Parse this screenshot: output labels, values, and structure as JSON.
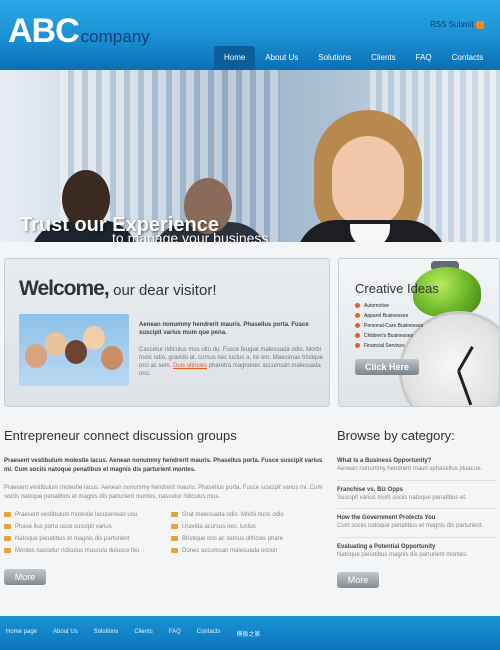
{
  "header": {
    "logo_main": "ABC",
    "logo_sub": "company",
    "rss_label": "RSS Submit",
    "nav": [
      "Home",
      "About Us",
      "Solutions",
      "Clients",
      "FAQ",
      "Contacts"
    ],
    "nav_active": "Home"
  },
  "hero": {
    "title": "Trust our Experience",
    "subtitle": "to manage your business..."
  },
  "welcome": {
    "title_big": "Welcome,",
    "title_small": "our dear visitor!",
    "bold_text": "Aenean nonummy hendrerit mauris. Phasellus porta. Fusce suscipit varius mum que pena.",
    "body_text": "Cascetur ridiculus mus ulto du. Fusce feugiat malesuada odio. Morbi nunc odio, gravido at, cursus nec luctus a, lor em. Maecenas tristique orci ac sem.",
    "link_text": "Duis ultricies",
    "body_text_end": "pharetra magnonec accumsan malesuada orci."
  },
  "creative": {
    "title": "Creative Ideas",
    "items": [
      "Automotive",
      "Apparel Businesses",
      "Personal-Care Businesses",
      "Children's Businesses",
      "Financial Services"
    ],
    "button": "Click Here"
  },
  "entrepreneur": {
    "title": "Entrepreneur connect discussion groups",
    "bold_text": "Praesent vestibulum molestie lacus. Aenean nonummy hendrerit mauris. Phasellus porta. Fusce suscipit varius mi. Cum sociis natoque penatibus et magnis dis parturient montes.",
    "body_text": "Praesent vestibulum molestie lacus. Aenean nonummy hendrerit mauris. Phasellus porta. Fusce suscipit varius mi. Cum sociis natoque penatibus et magnis dis parturient montes, nascetur ridiculus mus.",
    "list_left": [
      "Praesent vestibulum molestie lacusenean unu",
      "Phase llus porta usce suscipit varius",
      "Natoque penatibus et magnis dis parturient",
      "Montes nascetur ridiculus muscula duiusce feu"
    ],
    "list_right": [
      "Grat malesuada odio. Morbi nunc odio",
      "Uravida acursus nec, luctus",
      "Bristique orci ac semus ultricies phare",
      "Donec accumsan malesuada orcion"
    ],
    "more": "More"
  },
  "browse": {
    "title": "Browse by category:",
    "items": [
      {
        "title": "What Is a Business Opportunity?",
        "desc": "Aenean nonummy hendrerit mauri sphasellus pluacue."
      },
      {
        "title": "Franchise vs. Biz Opps",
        "desc": "Suscipit varius mum sociis natoque penatibus et."
      },
      {
        "title": "How the Government Protects You",
        "desc": "Cum sociis natoque penatibus et magnis dis parturient."
      },
      {
        "title": "Evaluating a Potential Opportunity",
        "desc": "Natoque penatibus magnis dis parturient montes."
      }
    ],
    "more": "More"
  },
  "footer": {
    "nav": [
      "Home page",
      "About Us",
      "Solutions",
      "Clients",
      "FAQ",
      "Contacts",
      "模板之家"
    ]
  }
}
